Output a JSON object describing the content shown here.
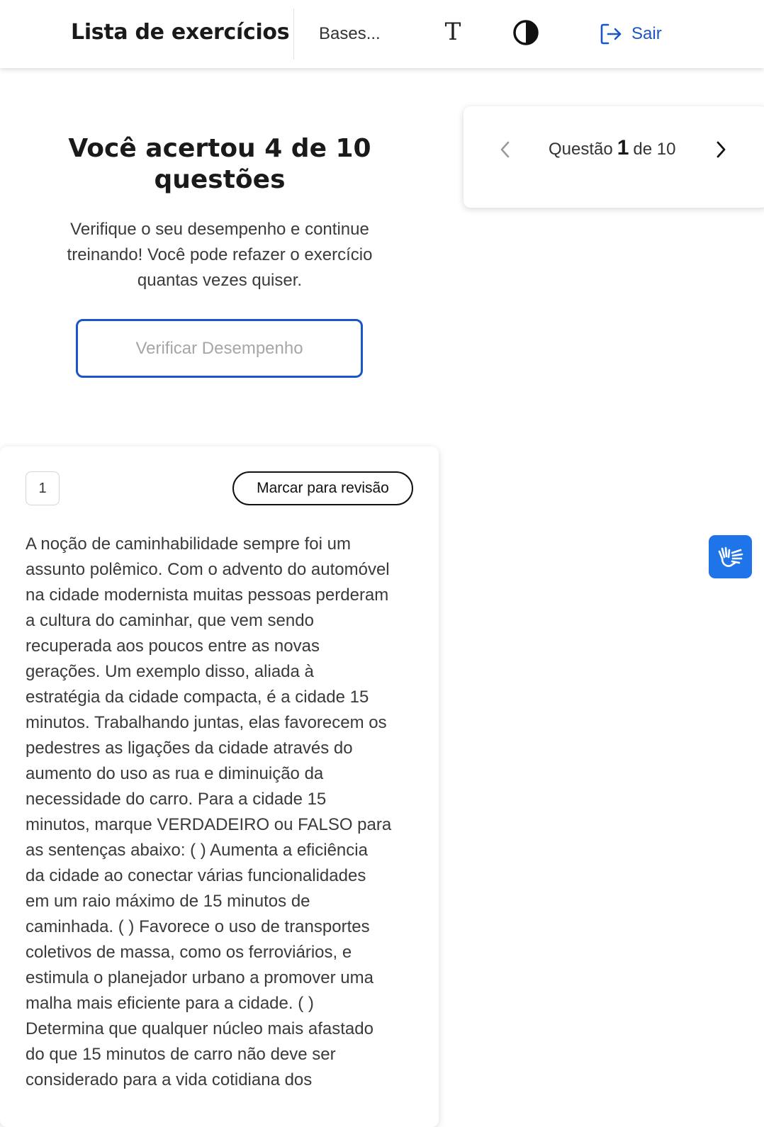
{
  "header": {
    "title": "Lista de exercícios",
    "subject": "Bases...",
    "font_size_icon": "T",
    "logout_label": "Sair"
  },
  "result": {
    "title": "Você acertou 4 de 10 questões",
    "description": "Verifique o seu desempenho e continue treinando! Você pode refazer o exercício quantas vezes quiser.",
    "check_button": "Verificar Desempenho"
  },
  "navigator": {
    "prefix": "Questão",
    "current": "1",
    "suffix": "de 10"
  },
  "question": {
    "number": "1",
    "review_button": "Marcar para revisão",
    "text": "A noção de caminhabilidade sempre foi um\nassunto polêmico. Com o advento do automóvel\nna cidade modernista muitas pessoas perderam\na cultura do caminhar, que vem sendo\nrecuperada aos poucos entre as novas\ngerações. Um exemplo disso, aliada à\nestratégia da cidade compacta, é a cidade 15\nminutos. Trabalhando juntas, elas favorecem os\npedestres as ligações da cidade através do\naumento do uso as rua e diminuição da\nnecessidade do carro. Para a cidade 15\nminutos, marque VERDADEIRO ou FALSO para\nas sentenças abaixo:   (   ) Aumenta a eficiência\nda cidade ao conectar várias funcionalidades\nem um raio máximo de 15 minutos de\ncaminhada. (   ) Favorece o uso de transportes\ncoletivos de massa, como os ferroviários, e\nestimula o planejador urbano a promover uma\nmalha mais eficiente para a cidade. (   )\nDetermina que qualquer núcleo mais afastado\ndo que 15 minutos de carro não deve ser\nconsiderado para a vida cotidiana dos"
  },
  "colors": {
    "accent": "#1a56c8",
    "libras_button": "#1e74e8"
  },
  "icons": {
    "font_size": "font-size-icon",
    "contrast": "contrast-icon",
    "logout": "logout-icon",
    "prev": "chevron-left-icon",
    "next": "chevron-right-icon",
    "libras": "sign-language-hands-icon"
  }
}
